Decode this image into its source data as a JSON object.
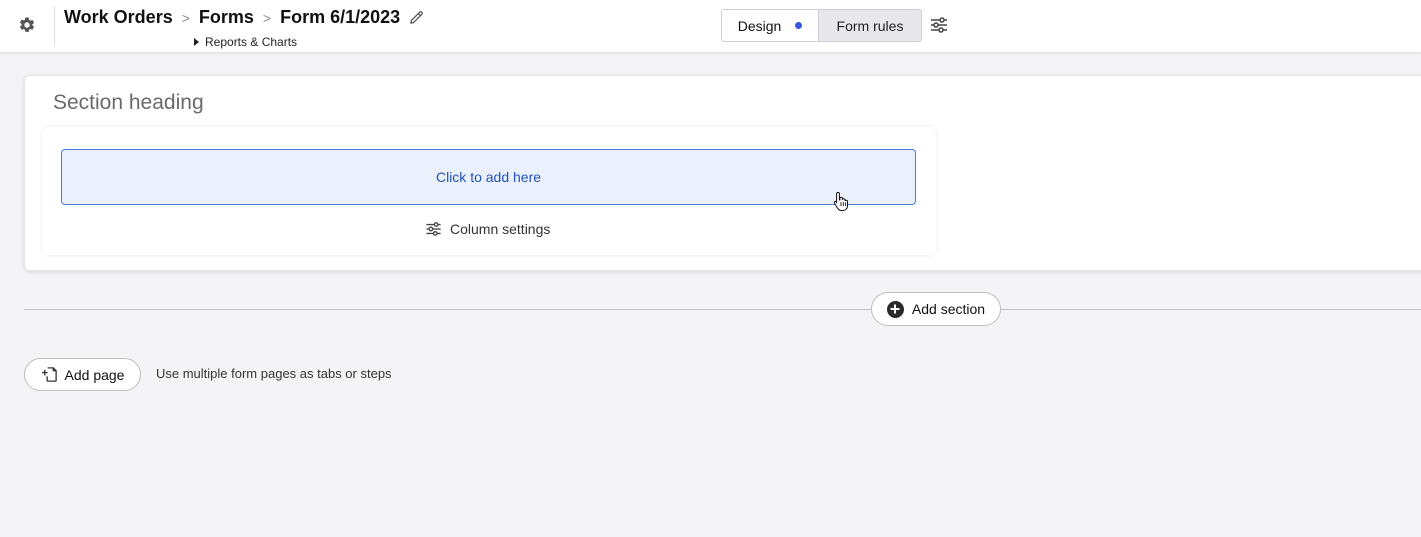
{
  "header": {
    "breadcrumb": [
      "Work Orders",
      "Forms",
      "Form 6/1/2023"
    ],
    "separator": ">",
    "sub_link": "Reports & Charts"
  },
  "mode_toggle": {
    "design_label": "Design",
    "rules_label": "Form rules",
    "active": "Design"
  },
  "section": {
    "heading": "Section heading",
    "add_here_label": "Click to add here",
    "column_settings_label": "Column settings"
  },
  "actions": {
    "add_section_label": "Add section",
    "add_page_label": "Add page",
    "add_page_hint": "Use multiple form pages as tabs or steps"
  },
  "icons": [
    "gear-icon",
    "pencil-icon",
    "sliders-icon",
    "plus-circle-icon",
    "add-page-icon",
    "pointer-hand-icon"
  ],
  "colors": {
    "accent": "#3856d8",
    "dropzone_bg": "#eaf1fd",
    "dropzone_border": "#4f79d9",
    "dropzone_text": "#2552b8",
    "page_bg": "#f4f4f6"
  }
}
